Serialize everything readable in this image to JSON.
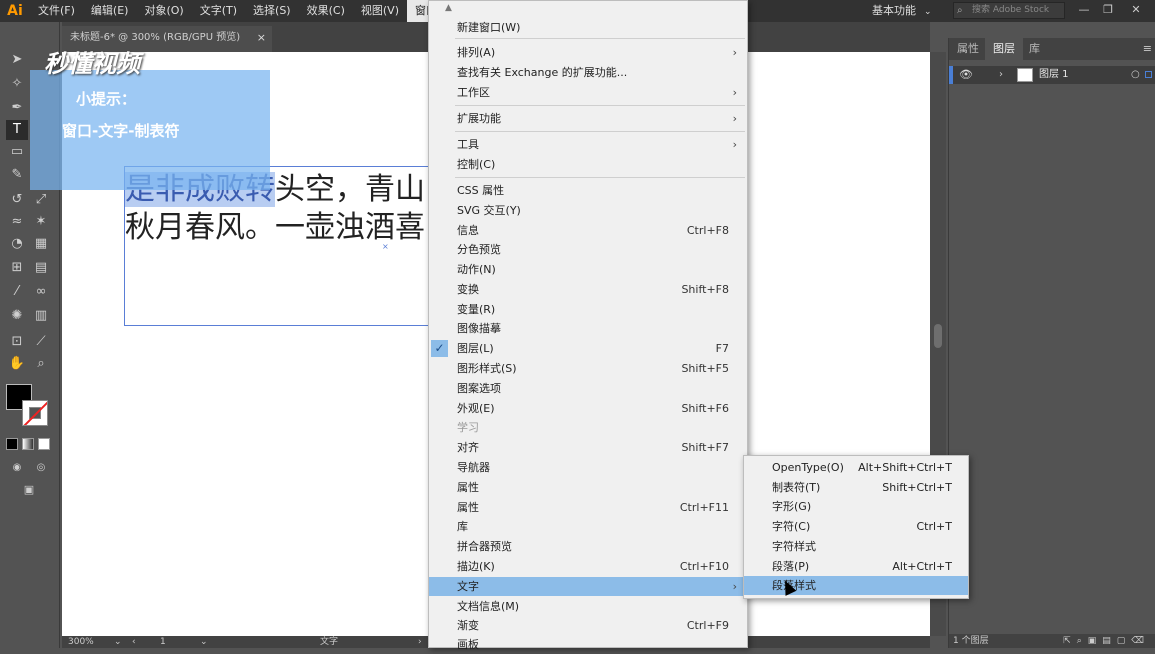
{
  "menubar": {
    "logo": "Ai",
    "items": [
      "文件(F)",
      "编辑(E)",
      "对象(O)",
      "文字(T)",
      "选择(S)",
      "效果(C)",
      "视图(V)",
      "窗口(W)"
    ],
    "workspace": "基本功能",
    "search_placeholder": "搜索 Adobe Stock"
  },
  "document_tab": {
    "title": "未标题-6* @ 300% (RGB/GPU 预览)",
    "close": "×"
  },
  "artboard": {
    "line1_selected": "是非成败转",
    "line1_rest": "头空，青山",
    "line2": "秋月春风。一壶浊酒喜"
  },
  "statusbar": {
    "zoom": "300%",
    "page": "1",
    "tool": "文字"
  },
  "right_panel": {
    "tabs": [
      "属性",
      "图层",
      "库"
    ],
    "layer_name": "图层 1",
    "footer_count": "1 个图层"
  },
  "hint": {
    "brand": "秒懂视频",
    "title": "小提示：",
    "body": "窗口-文字-制表符"
  },
  "window_menu": {
    "items": [
      {
        "label": "新建窗口(W)",
        "shortcut": "",
        "submenu": false
      },
      {
        "label": "排列(A)",
        "shortcut": "",
        "submenu": true
      },
      {
        "label": "查找有关 Exchange 的扩展功能...",
        "shortcut": "",
        "submenu": false
      },
      {
        "label": "工作区",
        "shortcut": "",
        "submenu": true
      },
      {
        "label": "扩展功能",
        "shortcut": "",
        "submenu": true
      },
      {
        "label": "工具",
        "shortcut": "",
        "submenu": true
      },
      {
        "label": "控制(C)",
        "shortcut": "",
        "submenu": false
      },
      {
        "label": "CSS 属性",
        "shortcut": "",
        "submenu": false
      },
      {
        "label": "SVG 交互(Y)",
        "shortcut": "",
        "submenu": false
      },
      {
        "label": "信息",
        "shortcut": "Ctrl+F8",
        "submenu": false
      },
      {
        "label": "分色预览",
        "shortcut": "",
        "submenu": false
      },
      {
        "label": "动作(N)",
        "shortcut": "",
        "submenu": false
      },
      {
        "label": "变换",
        "shortcut": "Shift+F8",
        "submenu": false
      },
      {
        "label": "变量(R)",
        "shortcut": "",
        "submenu": false
      },
      {
        "label": "图像描摹",
        "shortcut": "",
        "submenu": false
      },
      {
        "label": "图层(L)",
        "shortcut": "F7",
        "submenu": false,
        "checked": true
      },
      {
        "label": "图形样式(S)",
        "shortcut": "Shift+F5",
        "submenu": false
      },
      {
        "label": "图案选项",
        "shortcut": "",
        "submenu": false
      },
      {
        "label": "外观(E)",
        "shortcut": "Shift+F6",
        "submenu": false
      },
      {
        "label": "学习",
        "shortcut": "",
        "submenu": false,
        "disabled": true
      },
      {
        "label": "对齐",
        "shortcut": "Shift+F7",
        "submenu": false
      },
      {
        "label": "导航器",
        "shortcut": "",
        "submenu": false
      },
      {
        "label": "属性",
        "shortcut": "",
        "submenu": false
      },
      {
        "label": "属性",
        "shortcut": "Ctrl+F11",
        "submenu": false
      },
      {
        "label": "库",
        "shortcut": "",
        "submenu": false
      },
      {
        "label": "拼合器预览",
        "shortcut": "",
        "submenu": false
      },
      {
        "label": "描边(K)",
        "shortcut": "Ctrl+F10",
        "submenu": false
      },
      {
        "label": "文字",
        "shortcut": "",
        "submenu": true,
        "highlighted": true
      },
      {
        "label": "文档信息(M)",
        "shortcut": "",
        "submenu": false
      },
      {
        "label": "渐变",
        "shortcut": "Ctrl+F9",
        "submenu": false
      },
      {
        "label": "画板",
        "shortcut": "",
        "submenu": false
      }
    ]
  },
  "type_submenu": {
    "items": [
      {
        "label": "OpenType(O)",
        "shortcut": "Alt+Shift+Ctrl+T"
      },
      {
        "label": "制表符(T)",
        "shortcut": "Shift+Ctrl+T"
      },
      {
        "label": "字形(G)",
        "shortcut": ""
      },
      {
        "label": "字符(C)",
        "shortcut": "Ctrl+T"
      },
      {
        "label": "字符样式",
        "shortcut": ""
      },
      {
        "label": "段落(P)",
        "shortcut": "Alt+Ctrl+T"
      },
      {
        "label": "段落样式",
        "shortcut": "",
        "highlighted": true
      }
    ]
  },
  "colors": {
    "menu_highlight": "#8cbce8",
    "app_bg": "#535353",
    "menubar_bg": "#323232",
    "accent": "#ff9a00"
  }
}
